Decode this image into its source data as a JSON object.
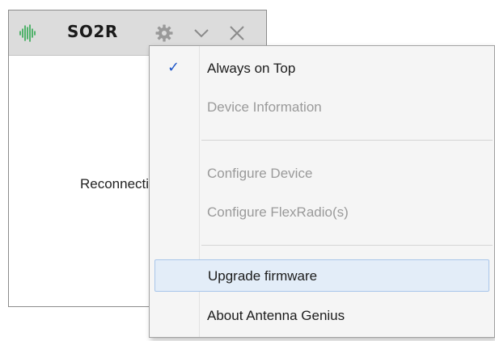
{
  "app": {
    "title": "SO2R",
    "status": "Reconnecting..."
  },
  "titlebar": {
    "icons": [
      "waveform-logo-icon",
      "gear-icon",
      "chevron-down-icon",
      "close-icon"
    ]
  },
  "menu": {
    "items": [
      {
        "label": "Always on Top",
        "checked": true,
        "enabled": true
      },
      {
        "label": "Device Information",
        "enabled": false
      },
      {
        "label": "Configure Device",
        "enabled": false
      },
      {
        "label": "Configure FlexRadio(s)",
        "enabled": false
      },
      {
        "label": "Upgrade firmware",
        "enabled": true,
        "highlighted": true
      },
      {
        "label": "About Antenna Genius",
        "enabled": true
      }
    ],
    "check_mark": "✓"
  },
  "colors": {
    "logo_green": "#2fa84f",
    "titlebar_bg": "#dcdcdc",
    "check_blue": "#1f57c9",
    "highlight_bg": "#e3edf8",
    "highlight_border": "#a8c6ea",
    "disabled_text": "#9a9a9a"
  }
}
